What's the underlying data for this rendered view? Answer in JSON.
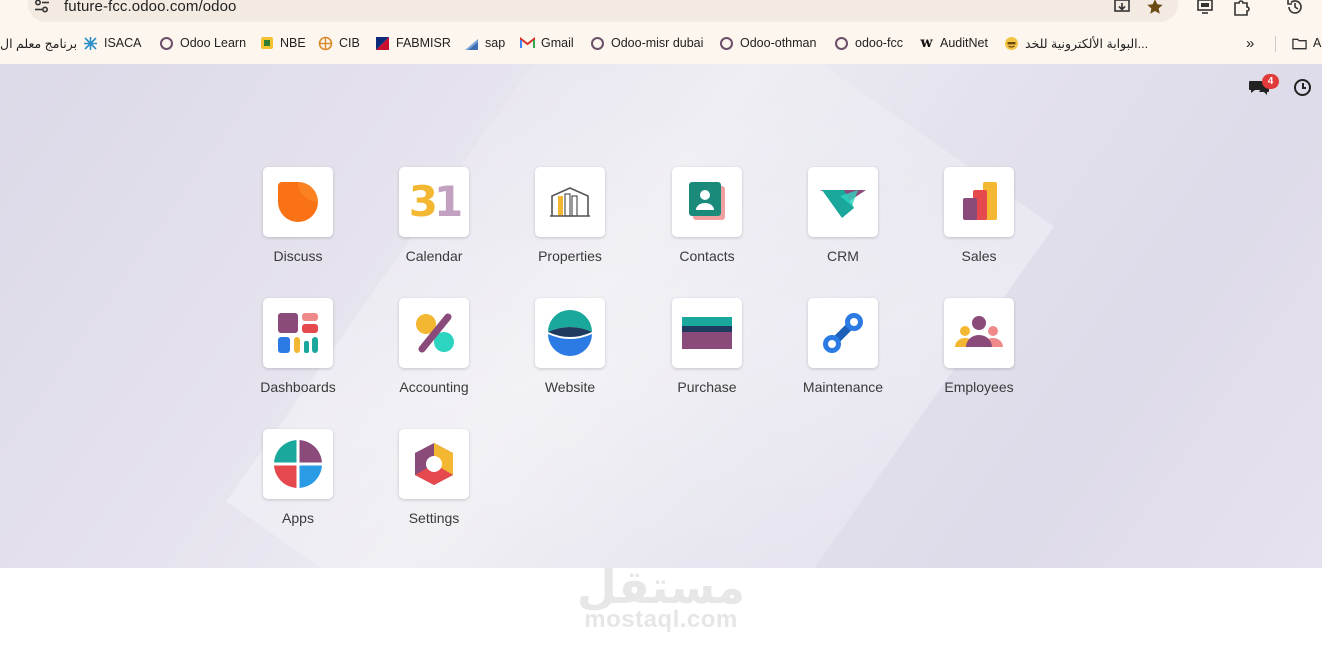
{
  "browser": {
    "url": "future-fcc.odoo.com/odoo",
    "bookmarks": [
      {
        "label": "برنامج معلم ال",
        "icon": "none"
      },
      {
        "label": "ISACA",
        "icon": "isaca-icon"
      },
      {
        "label": "Odoo Learn",
        "icon": "odoo-ring-icon"
      },
      {
        "label": "NBE",
        "icon": "nbe-icon"
      },
      {
        "label": "CIB",
        "icon": "cib-icon"
      },
      {
        "label": "FABMISR",
        "icon": "fabmisr-icon"
      },
      {
        "label": "sap",
        "icon": "sap-icon"
      },
      {
        "label": "Gmail",
        "icon": "gmail-icon"
      },
      {
        "label": "Odoo-misr dubai",
        "icon": "odoo-ring-icon"
      },
      {
        "label": "Odoo-othman",
        "icon": "odoo-ring-icon"
      },
      {
        "label": "odoo-fcc",
        "icon": "odoo-ring-icon"
      },
      {
        "label": "AuditNet",
        "icon": "auditnet-icon"
      },
      {
        "label": "البوابة الألكترونية للخد...",
        "icon": "emoji-icon"
      }
    ],
    "more_bookmarks": "»",
    "all_bookmarks_partial": "A"
  },
  "systray": {
    "chat_badge": "4"
  },
  "apps": [
    {
      "label": "Discuss",
      "icon": "discuss-icon"
    },
    {
      "label": "Calendar",
      "icon": "calendar-icon",
      "icon_text": "31"
    },
    {
      "label": "Properties",
      "icon": "properties-icon"
    },
    {
      "label": "Contacts",
      "icon": "contacts-icon"
    },
    {
      "label": "CRM",
      "icon": "crm-icon"
    },
    {
      "label": "Sales",
      "icon": "sales-icon"
    },
    {
      "label": "Dashboards",
      "icon": "dashboards-icon"
    },
    {
      "label": "Accounting",
      "icon": "accounting-icon"
    },
    {
      "label": "Website",
      "icon": "website-icon"
    },
    {
      "label": "Purchase",
      "icon": "purchase-icon"
    },
    {
      "label": "Maintenance",
      "icon": "maintenance-icon"
    },
    {
      "label": "Employees",
      "icon": "employees-icon"
    },
    {
      "label": "Apps",
      "icon": "apps-icon"
    },
    {
      "label": "Settings",
      "icon": "settings-icon"
    }
  ],
  "watermark": {
    "arabic": "مستقل",
    "english": "mostaql.com"
  },
  "colors": {
    "orange": "#f97316",
    "teal": "#1aa89c",
    "purple": "#8a4a7a",
    "yellow": "#f4b731",
    "blue": "#2c7be5",
    "red": "#e5484d"
  }
}
